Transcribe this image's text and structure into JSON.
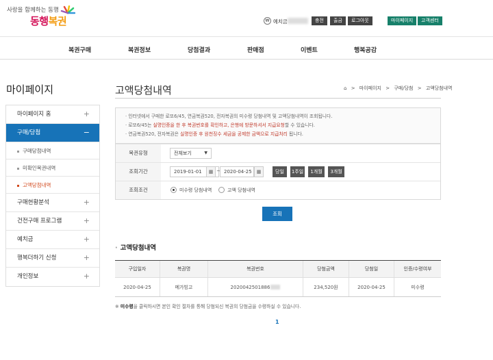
{
  "header": {
    "tagline": "사랑을 함께하는 동행",
    "logo_part1": "동행",
    "logo_part2": "복권",
    "balance_label": "예치금",
    "buttons": [
      "충전",
      "출금",
      "로그아웃"
    ],
    "green_buttons": [
      "마이페이지",
      "고객센터"
    ]
  },
  "gnb": [
    "복권구매",
    "복권정보",
    "당첨결과",
    "판매점",
    "이벤트",
    "행복공감"
  ],
  "sidebar": {
    "title": "마이페이지",
    "items": [
      {
        "label": "마이페이지 홈",
        "pm": "+"
      },
      {
        "label": "구매/당첨",
        "pm": "−"
      }
    ],
    "subs": [
      "구매당첨내역",
      "미확인복권내역",
      "고액당첨내역"
    ],
    "items2": [
      {
        "label": "구매현황분석",
        "pm": "+"
      },
      {
        "label": "건전구매 프로그램",
        "pm": "+"
      },
      {
        "label": "예치금",
        "pm": "+"
      },
      {
        "label": "행복더하기 신청",
        "pm": "+"
      },
      {
        "label": "개인정보",
        "pm": "+"
      }
    ]
  },
  "main": {
    "title": "고액당첨내역",
    "breadcrumb": [
      "마이페이지",
      ">",
      "구매/당첨",
      ">",
      "고액당첨내역"
    ],
    "notice": {
      "line1": "인터넷에서 구매한 로또6/45, 연금복권520, 전자복권의 미수령 당첨내역 및 고액당첨내역이 조회됩니다.",
      "line2_pre": "로또6/45는 ",
      "line2_red": "실명인증을 한 후 복권번호를 확인하고, 은행에 방문하셔서 지급요청",
      "line2_post": "할 수 있습니다.",
      "line3_pre": "연금복권520, 전자복권은 ",
      "line3_red": "실명인증 후 원천징수 세금을 공제한 금액으로 지급처리",
      "line3_post": " 됩니다."
    },
    "search": {
      "type_label": "복권유형",
      "type_value": "전체보기",
      "period_label": "조회기간",
      "date_from": "2019-01-01",
      "date_to": "2020-04-25",
      "tilde": "~",
      "period_buttons": [
        "당일",
        "1주일",
        "1개월",
        "3개월"
      ],
      "cond_label": "조회조건",
      "cond_options": [
        "미수령 당첨내역",
        "고액 당첨내역"
      ],
      "query_button": "조회"
    },
    "section_title": "고액당첨내역",
    "table": {
      "headers": [
        "구입일자",
        "복권명",
        "복권번호",
        "당첨금액",
        "당첨일",
        "인증/수령여부"
      ],
      "row": {
        "date": "2020-04-25",
        "name": "메가빙고",
        "number": "2020042501886",
        "amount": "234,520원",
        "win_date": "2020-04-25",
        "status": "미수령"
      }
    },
    "footnote_pre": "※ ",
    "footnote_bold": "미수령",
    "footnote_post": "을 클릭하시면 본인 확인 절차를 통해 당첨되신 복권의 당첨금을 수령하실 수 있습니다.",
    "pager": "1"
  }
}
